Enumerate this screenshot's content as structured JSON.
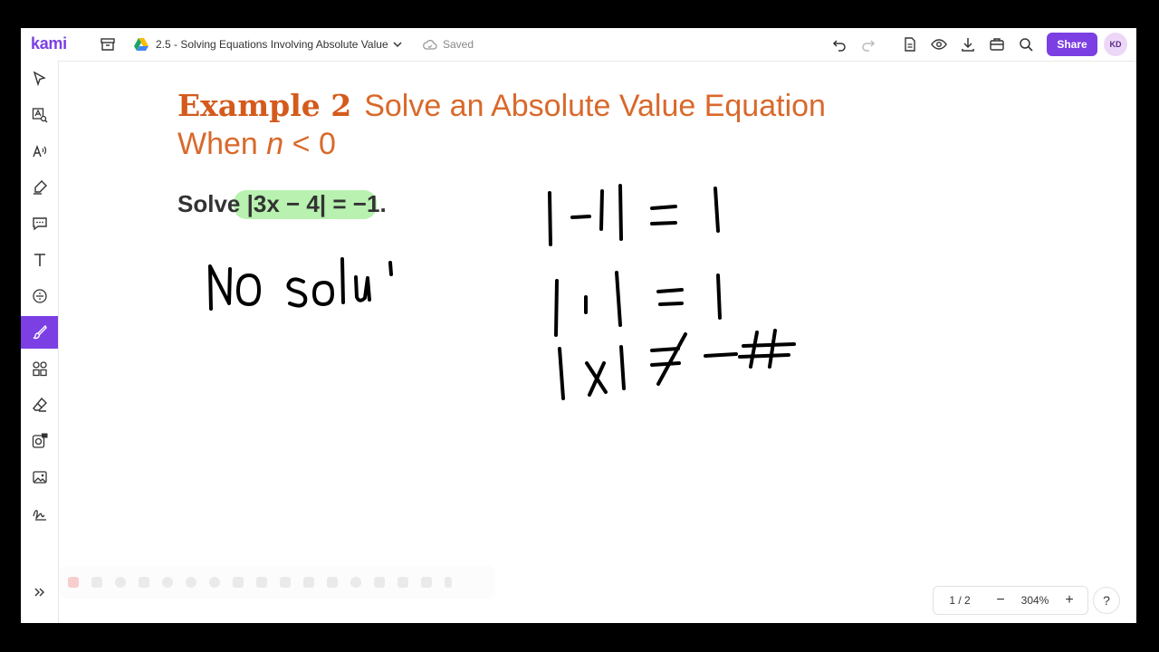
{
  "app": {
    "logo": "kami",
    "brand_color": "#7b3fe4"
  },
  "header": {
    "doc_title": "2.5 - Solving Equations Involving Absolute Value",
    "save_status": "Saved",
    "share_label": "Share",
    "avatar_initials": "KD"
  },
  "sidebar": {
    "tools": [
      "select-tool",
      "text-select-tool",
      "read-aloud-tool",
      "highlight-tool",
      "comment-tool",
      "text-tool",
      "equation-tool",
      "draw-tool",
      "shapes-tool",
      "eraser-tool",
      "add-media-tool",
      "image-tool",
      "signature-tool"
    ],
    "active_tool": "draw-tool"
  },
  "document": {
    "example_label": "Example 2",
    "example_title": "Solve an Absolute Value Equation",
    "example_subtitle_prefix": "When",
    "example_subtitle_var": "n",
    "example_subtitle_rest": " < 0",
    "solve_word": "Solve",
    "solve_expr": "|3x − 4| = −1.",
    "highlight_color": "#b8f1b0"
  },
  "footer": {
    "page_indicator": "1 / 2",
    "zoom": "304%",
    "help": "?"
  }
}
